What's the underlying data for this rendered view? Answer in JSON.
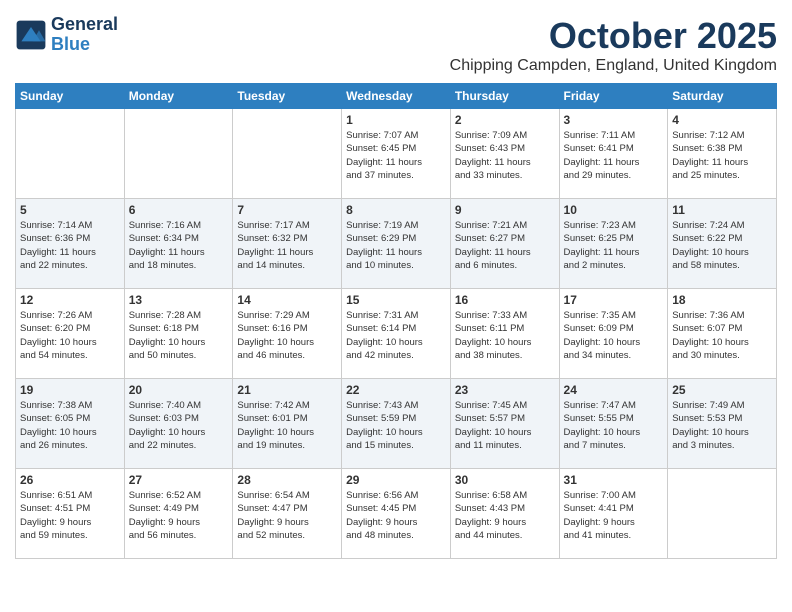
{
  "logo": {
    "line1": "General",
    "line2": "Blue"
  },
  "title": "October 2025",
  "subtitle": "Chipping Campden, England, United Kingdom",
  "weekdays": [
    "Sunday",
    "Monday",
    "Tuesday",
    "Wednesday",
    "Thursday",
    "Friday",
    "Saturday"
  ],
  "weeks": [
    [
      {
        "day": "",
        "content": ""
      },
      {
        "day": "",
        "content": ""
      },
      {
        "day": "",
        "content": ""
      },
      {
        "day": "1",
        "content": "Sunrise: 7:07 AM\nSunset: 6:45 PM\nDaylight: 11 hours\nand 37 minutes."
      },
      {
        "day": "2",
        "content": "Sunrise: 7:09 AM\nSunset: 6:43 PM\nDaylight: 11 hours\nand 33 minutes."
      },
      {
        "day": "3",
        "content": "Sunrise: 7:11 AM\nSunset: 6:41 PM\nDaylight: 11 hours\nand 29 minutes."
      },
      {
        "day": "4",
        "content": "Sunrise: 7:12 AM\nSunset: 6:38 PM\nDaylight: 11 hours\nand 25 minutes."
      }
    ],
    [
      {
        "day": "5",
        "content": "Sunrise: 7:14 AM\nSunset: 6:36 PM\nDaylight: 11 hours\nand 22 minutes."
      },
      {
        "day": "6",
        "content": "Sunrise: 7:16 AM\nSunset: 6:34 PM\nDaylight: 11 hours\nand 18 minutes."
      },
      {
        "day": "7",
        "content": "Sunrise: 7:17 AM\nSunset: 6:32 PM\nDaylight: 11 hours\nand 14 minutes."
      },
      {
        "day": "8",
        "content": "Sunrise: 7:19 AM\nSunset: 6:29 PM\nDaylight: 11 hours\nand 10 minutes."
      },
      {
        "day": "9",
        "content": "Sunrise: 7:21 AM\nSunset: 6:27 PM\nDaylight: 11 hours\nand 6 minutes."
      },
      {
        "day": "10",
        "content": "Sunrise: 7:23 AM\nSunset: 6:25 PM\nDaylight: 11 hours\nand 2 minutes."
      },
      {
        "day": "11",
        "content": "Sunrise: 7:24 AM\nSunset: 6:22 PM\nDaylight: 10 hours\nand 58 minutes."
      }
    ],
    [
      {
        "day": "12",
        "content": "Sunrise: 7:26 AM\nSunset: 6:20 PM\nDaylight: 10 hours\nand 54 minutes."
      },
      {
        "day": "13",
        "content": "Sunrise: 7:28 AM\nSunset: 6:18 PM\nDaylight: 10 hours\nand 50 minutes."
      },
      {
        "day": "14",
        "content": "Sunrise: 7:29 AM\nSunset: 6:16 PM\nDaylight: 10 hours\nand 46 minutes."
      },
      {
        "day": "15",
        "content": "Sunrise: 7:31 AM\nSunset: 6:14 PM\nDaylight: 10 hours\nand 42 minutes."
      },
      {
        "day": "16",
        "content": "Sunrise: 7:33 AM\nSunset: 6:11 PM\nDaylight: 10 hours\nand 38 minutes."
      },
      {
        "day": "17",
        "content": "Sunrise: 7:35 AM\nSunset: 6:09 PM\nDaylight: 10 hours\nand 34 minutes."
      },
      {
        "day": "18",
        "content": "Sunrise: 7:36 AM\nSunset: 6:07 PM\nDaylight: 10 hours\nand 30 minutes."
      }
    ],
    [
      {
        "day": "19",
        "content": "Sunrise: 7:38 AM\nSunset: 6:05 PM\nDaylight: 10 hours\nand 26 minutes."
      },
      {
        "day": "20",
        "content": "Sunrise: 7:40 AM\nSunset: 6:03 PM\nDaylight: 10 hours\nand 22 minutes."
      },
      {
        "day": "21",
        "content": "Sunrise: 7:42 AM\nSunset: 6:01 PM\nDaylight: 10 hours\nand 19 minutes."
      },
      {
        "day": "22",
        "content": "Sunrise: 7:43 AM\nSunset: 5:59 PM\nDaylight: 10 hours\nand 15 minutes."
      },
      {
        "day": "23",
        "content": "Sunrise: 7:45 AM\nSunset: 5:57 PM\nDaylight: 10 hours\nand 11 minutes."
      },
      {
        "day": "24",
        "content": "Sunrise: 7:47 AM\nSunset: 5:55 PM\nDaylight: 10 hours\nand 7 minutes."
      },
      {
        "day": "25",
        "content": "Sunrise: 7:49 AM\nSunset: 5:53 PM\nDaylight: 10 hours\nand 3 minutes."
      }
    ],
    [
      {
        "day": "26",
        "content": "Sunrise: 6:51 AM\nSunset: 4:51 PM\nDaylight: 9 hours\nand 59 minutes."
      },
      {
        "day": "27",
        "content": "Sunrise: 6:52 AM\nSunset: 4:49 PM\nDaylight: 9 hours\nand 56 minutes."
      },
      {
        "day": "28",
        "content": "Sunrise: 6:54 AM\nSunset: 4:47 PM\nDaylight: 9 hours\nand 52 minutes."
      },
      {
        "day": "29",
        "content": "Sunrise: 6:56 AM\nSunset: 4:45 PM\nDaylight: 9 hours\nand 48 minutes."
      },
      {
        "day": "30",
        "content": "Sunrise: 6:58 AM\nSunset: 4:43 PM\nDaylight: 9 hours\nand 44 minutes."
      },
      {
        "day": "31",
        "content": "Sunrise: 7:00 AM\nSunset: 4:41 PM\nDaylight: 9 hours\nand 41 minutes."
      },
      {
        "day": "",
        "content": ""
      }
    ]
  ]
}
